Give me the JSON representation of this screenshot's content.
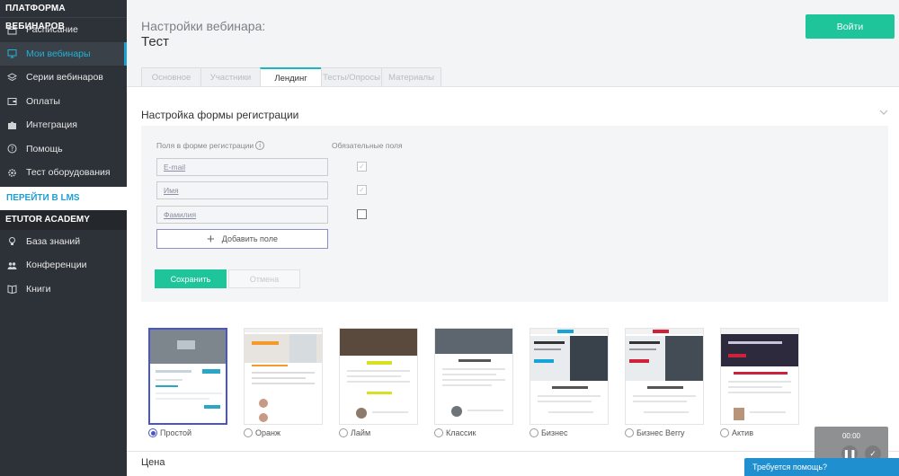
{
  "sidebar": {
    "platform_title": "ПЛАТФОРМА ВЕБИНАРОВ",
    "items": [
      {
        "label": "Расписание",
        "icon": "calendar-icon"
      },
      {
        "label": "Мои вебинары",
        "icon": "monitor-icon",
        "active": true
      },
      {
        "label": "Серии вебинаров",
        "icon": "layers-icon"
      },
      {
        "label": "Оплаты",
        "icon": "wallet-icon"
      },
      {
        "label": "Интеграция",
        "icon": "puzzle-icon"
      },
      {
        "label": "Помощь",
        "icon": "question-icon"
      },
      {
        "label": "Тест оборудования",
        "icon": "gear-icon"
      }
    ],
    "lms_link": "ПЕРЕЙТИ В LMS",
    "academy_title": "ETUTOR ACADEMY",
    "academy_items": [
      {
        "label": "База знаний",
        "icon": "bulb-icon"
      },
      {
        "label": "Конференции",
        "icon": "people-icon"
      },
      {
        "label": "Книги",
        "icon": "book-icon"
      }
    ]
  },
  "header": {
    "subtitle": "Настройки вебинара:",
    "title": "Тест",
    "login_button": "Войти"
  },
  "tabs": [
    {
      "label": "Основное"
    },
    {
      "label": "Участники"
    },
    {
      "label": "Лендинг",
      "active": true
    },
    {
      "label": "Тесты/Опросы"
    },
    {
      "label": "Материалы"
    }
  ],
  "registration": {
    "section_title": "Настройка формы регистрации",
    "fields_label": "Поля в форме регистрации",
    "required_label": "Обязательные поля",
    "fields": [
      {
        "name": "E-mail",
        "required": true,
        "locked": true
      },
      {
        "name": "Имя",
        "required": true,
        "locked": true
      },
      {
        "name": "Фамилия",
        "required": false,
        "locked": false
      }
    ],
    "add_field_button": "Добавить поле",
    "save_button": "Сохранить",
    "cancel_button": "Отмена"
  },
  "templates": [
    {
      "label": "Простой",
      "selected": true
    },
    {
      "label": "Оранж",
      "selected": false
    },
    {
      "label": "Лайм",
      "selected": false
    },
    {
      "label": "Классик",
      "selected": false
    },
    {
      "label": "Бизнес",
      "selected": false
    },
    {
      "label": "Бизнес Berry",
      "selected": false
    },
    {
      "label": "Актив",
      "selected": false
    }
  ],
  "price_title": "Цена",
  "video_widget": {
    "time": "00:00"
  },
  "help_button": "Требуется помощь?",
  "colors": {
    "sidebar_bg": "#2d3238",
    "accent_green": "#1ec49a",
    "accent_blue": "#1f8fd0",
    "active_tab_border": "#16b8c4",
    "selected_template_border": "#4a55c7"
  }
}
